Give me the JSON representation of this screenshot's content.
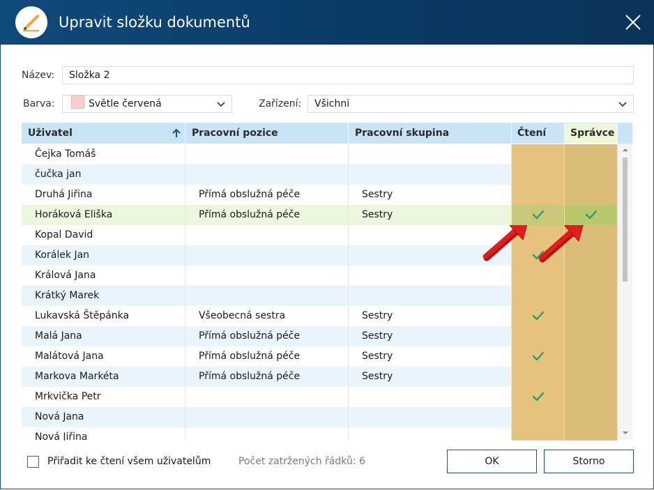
{
  "window": {
    "title": "Upravit složku dokumentů"
  },
  "form": {
    "name_label": "Název:",
    "name_value": "Složka 2",
    "color_label": "Barva:",
    "color_value": "Světle červená",
    "color_swatch": "#f7d0cc",
    "device_label": "Zařízení:",
    "device_value": "Všichni"
  },
  "table": {
    "headers": [
      "Uživatel",
      "Pracovní pozice",
      "Pracovní skupina",
      "Čtení",
      "Správce"
    ],
    "sort_icon": "arrow-up-icon",
    "rows": [
      {
        "name": "Čejka Tomáš",
        "position": "",
        "group": "",
        "read": false,
        "admin": false
      },
      {
        "name": "čučka jan",
        "position": "",
        "group": "",
        "read": false,
        "admin": false
      },
      {
        "name": "Druhá Jiřina",
        "position": "Přímá obslužná péče",
        "group": "Sestry",
        "read": false,
        "admin": false
      },
      {
        "name": "Horáková Eliška",
        "position": "Přímá obslužná péče",
        "group": "Sestry",
        "read": true,
        "admin": true,
        "selected": true
      },
      {
        "name": "Kopal David",
        "position": "",
        "group": "",
        "read": false,
        "admin": false
      },
      {
        "name": "Korálek Jan",
        "position": "",
        "group": "",
        "read": true,
        "admin": false
      },
      {
        "name": "Králová Jana",
        "position": "",
        "group": "",
        "read": false,
        "admin": false
      },
      {
        "name": "Krátký Marek",
        "position": "",
        "group": "",
        "read": false,
        "admin": false
      },
      {
        "name": "Lukavská Štěpánka",
        "position": "Všeobecná sestra",
        "group": "Sestry",
        "read": true,
        "admin": false
      },
      {
        "name": "Malá Jana",
        "position": "Přímá obslužná péče",
        "group": "Sestry",
        "read": false,
        "admin": false
      },
      {
        "name": "Malátová Jana",
        "position": "Přímá obslužná péče",
        "group": "Sestry",
        "read": true,
        "admin": false
      },
      {
        "name": "Markova Markéta",
        "position": "Přímá obslužná péče",
        "group": "Sestry",
        "read": false,
        "admin": false
      },
      {
        "name": "Mrkvička Petr",
        "position": "",
        "group": "",
        "read": true,
        "admin": false
      },
      {
        "name": "Nová Jana",
        "position": "",
        "group": "",
        "read": false,
        "admin": false
      },
      {
        "name": "Nová Jiřina",
        "position": "",
        "group": "",
        "read": false,
        "admin": false
      }
    ]
  },
  "footer": {
    "assign_all_label": "Přiřadit ke čtení všem uživatelům",
    "checked_count": "Počet zatržených řádků: 6",
    "ok_label": "OK",
    "cancel_label": "Storno"
  },
  "colors": {
    "titlebar": "#0b3b66",
    "header_bg": "#c9e4f4",
    "read_col": "#e6c47f",
    "admin_col": "#dbbd7a",
    "selection_border": "#5d9a32",
    "check": "#2a9d68",
    "annotation_arrow": "#e01e1e"
  }
}
